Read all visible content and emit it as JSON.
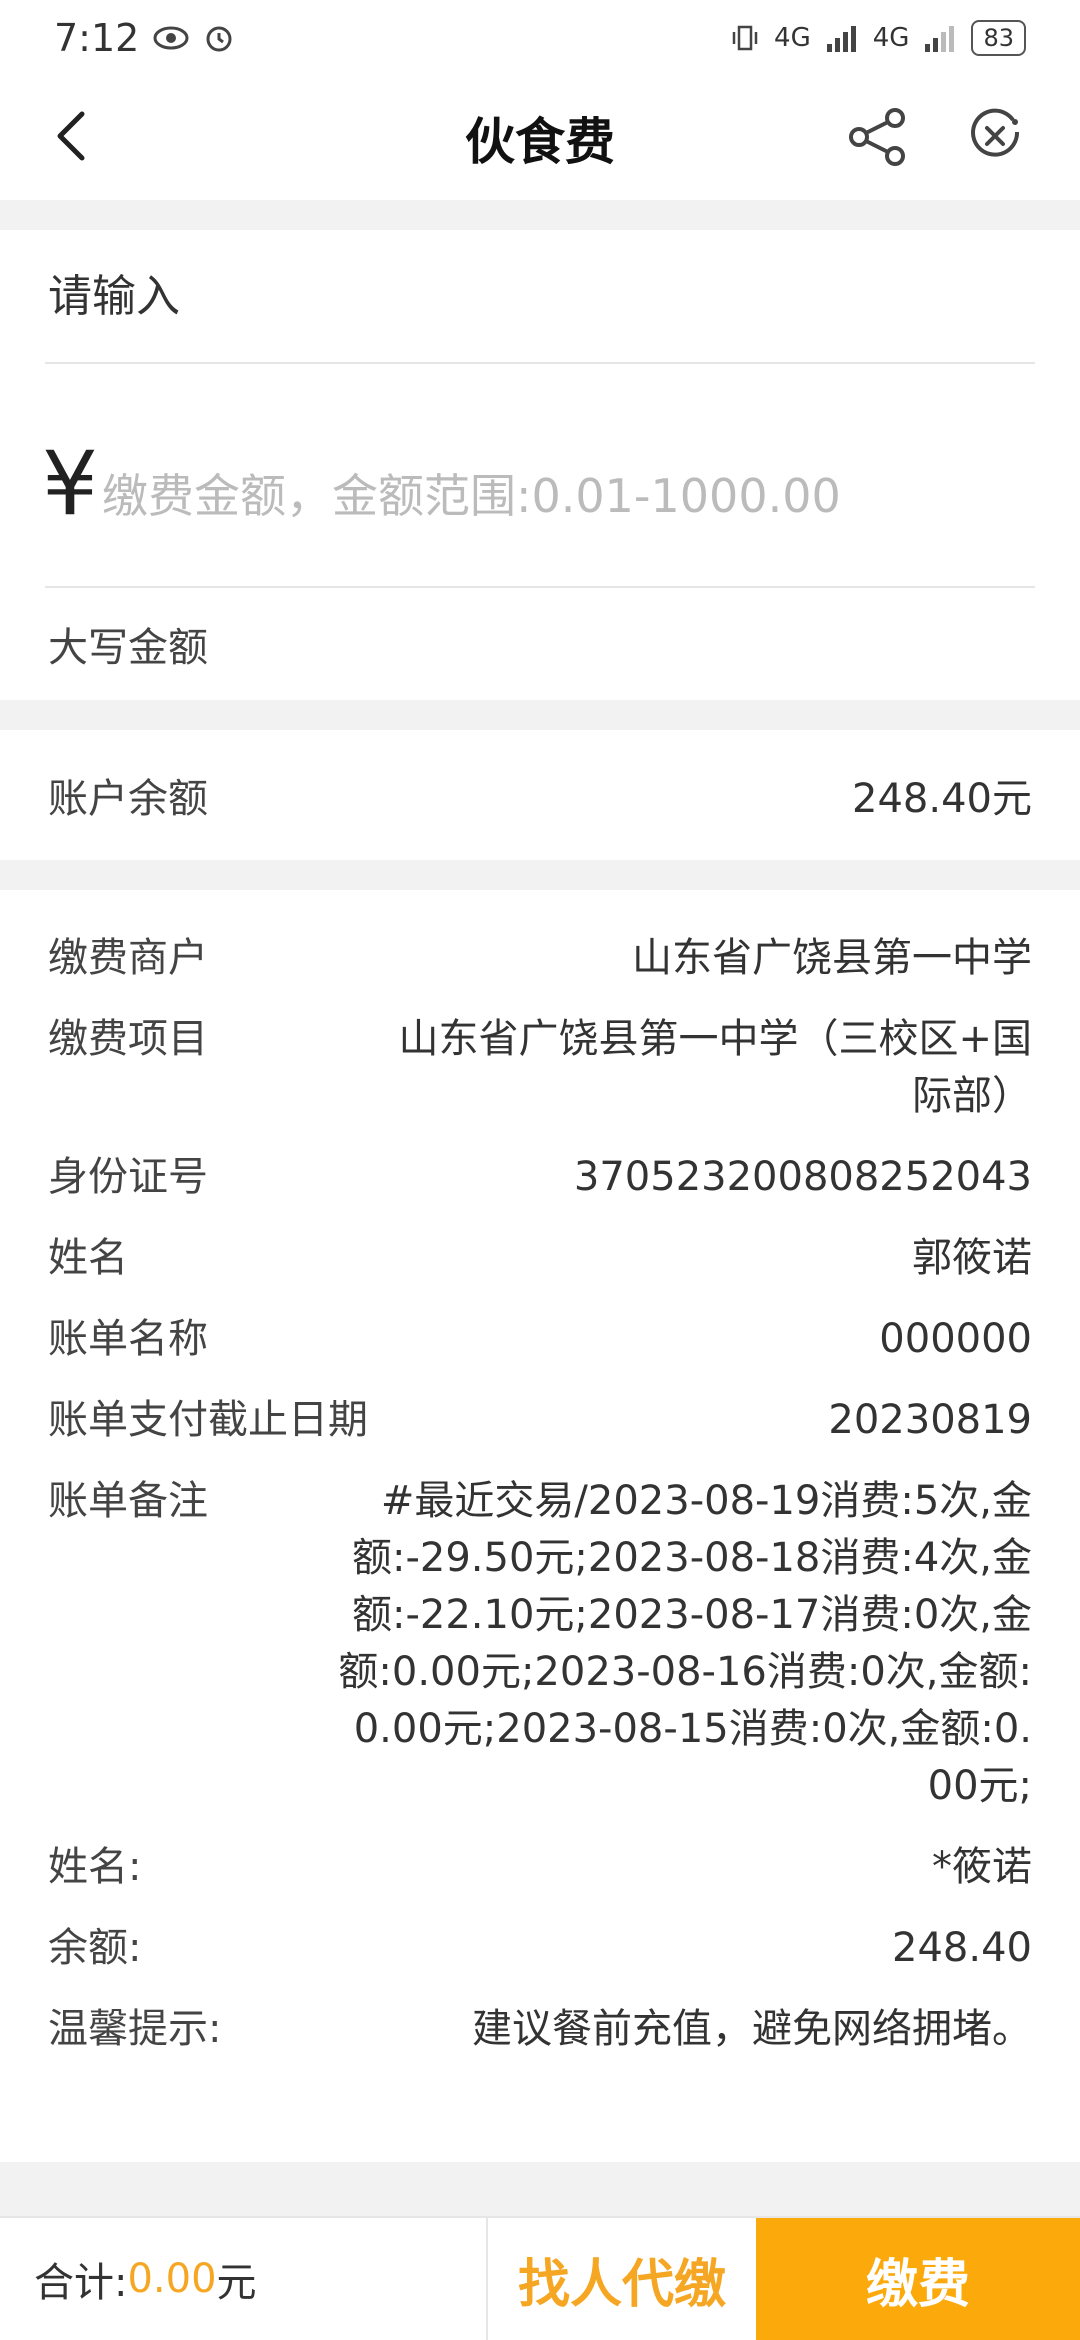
{
  "status": {
    "time": "7:12",
    "network1": "4G",
    "network2": "4G",
    "battery": "83"
  },
  "nav": {
    "title": "伙食费"
  },
  "input": {
    "label": "请输入",
    "currency": "¥",
    "placeholder": "缴费金额，金额范围:0.01-1000.00",
    "uppercase_label": "大写金额"
  },
  "balance": {
    "label": "账户余额",
    "value": "248.40元"
  },
  "details": [
    {
      "key": "缴费商户",
      "value": "山东省广饶县第一中学"
    },
    {
      "key": "缴费项目",
      "value": "山东省广饶县第一中学（三校区+国际部）"
    },
    {
      "key": "身份证号",
      "value": "370523200808252043"
    },
    {
      "key": "姓名",
      "value": "郭筱诺"
    },
    {
      "key": "账单名称",
      "value": "000000"
    },
    {
      "key": "账单支付截止日期",
      "value": "20230819"
    },
    {
      "key": "账单备注",
      "value": "#最近交易/2023-08-19消费:5次,金额:-29.50元;2023-08-18消费:4次,金额:-22.10元;2023-08-17消费:0次,金额:0.00元;2023-08-16消费:0次,金额:0.00元;2023-08-15消费:0次,金额:0.00元;"
    },
    {
      "key": "姓名:",
      "value": "*筱诺"
    },
    {
      "key": "余额:",
      "value": "248.40"
    },
    {
      "key": "温馨提示:",
      "value": "建议餐前充值，避免网络拥堵。"
    }
  ],
  "footer": {
    "total_label": "合计:",
    "total_amount": "0.00",
    "total_unit": "元",
    "agent_button": "找人代缴",
    "pay_button": "缴费"
  },
  "colors": {
    "accent": "#fca90b",
    "accent_text": "#f5a623"
  }
}
